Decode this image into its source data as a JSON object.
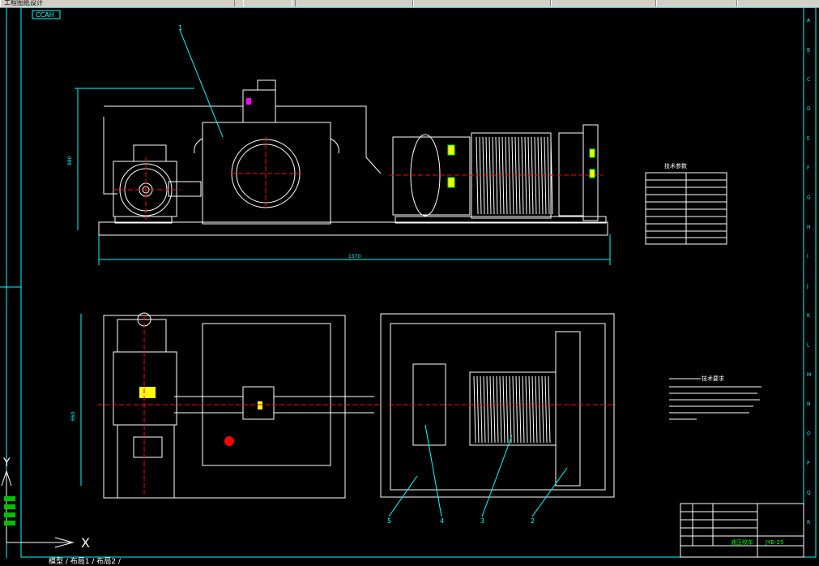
{
  "toolbar": {
    "tabs": [
      "工程图纸设计",
      "",
      "",
      "",
      "",
      "",
      "",
      ""
    ]
  },
  "drawing": {
    "sheet_tag": "CCAH",
    "dim_overall_width": "1570",
    "dim_height_top": "880",
    "dim_height_bottom": "660",
    "table_title": "技术参数",
    "notes_title": "技术要求",
    "balloons": [
      "1",
      "2",
      "3",
      "4",
      "5"
    ],
    "border_letters_right": [
      "A",
      "B",
      "C",
      "D",
      "E",
      "F",
      "G",
      "H",
      "I",
      "J",
      "K",
      "L",
      "M",
      "N",
      "O",
      "P",
      "Q",
      "R"
    ],
    "title_block_name": "液压绞车",
    "title_block_code": "JYB-25"
  },
  "ucs": {
    "x_label": "X",
    "y_label": "Y"
  },
  "statusbar": {
    "text": "模型 / 布局1 / 布局2 /"
  },
  "colors": {
    "background": "#000000",
    "outline": "#ffffff",
    "centerline": "#ff0000",
    "dimension": "#00ffff",
    "hatch": "#ffff00",
    "highlight": "#00ff00",
    "accent": "#ff00ff"
  }
}
